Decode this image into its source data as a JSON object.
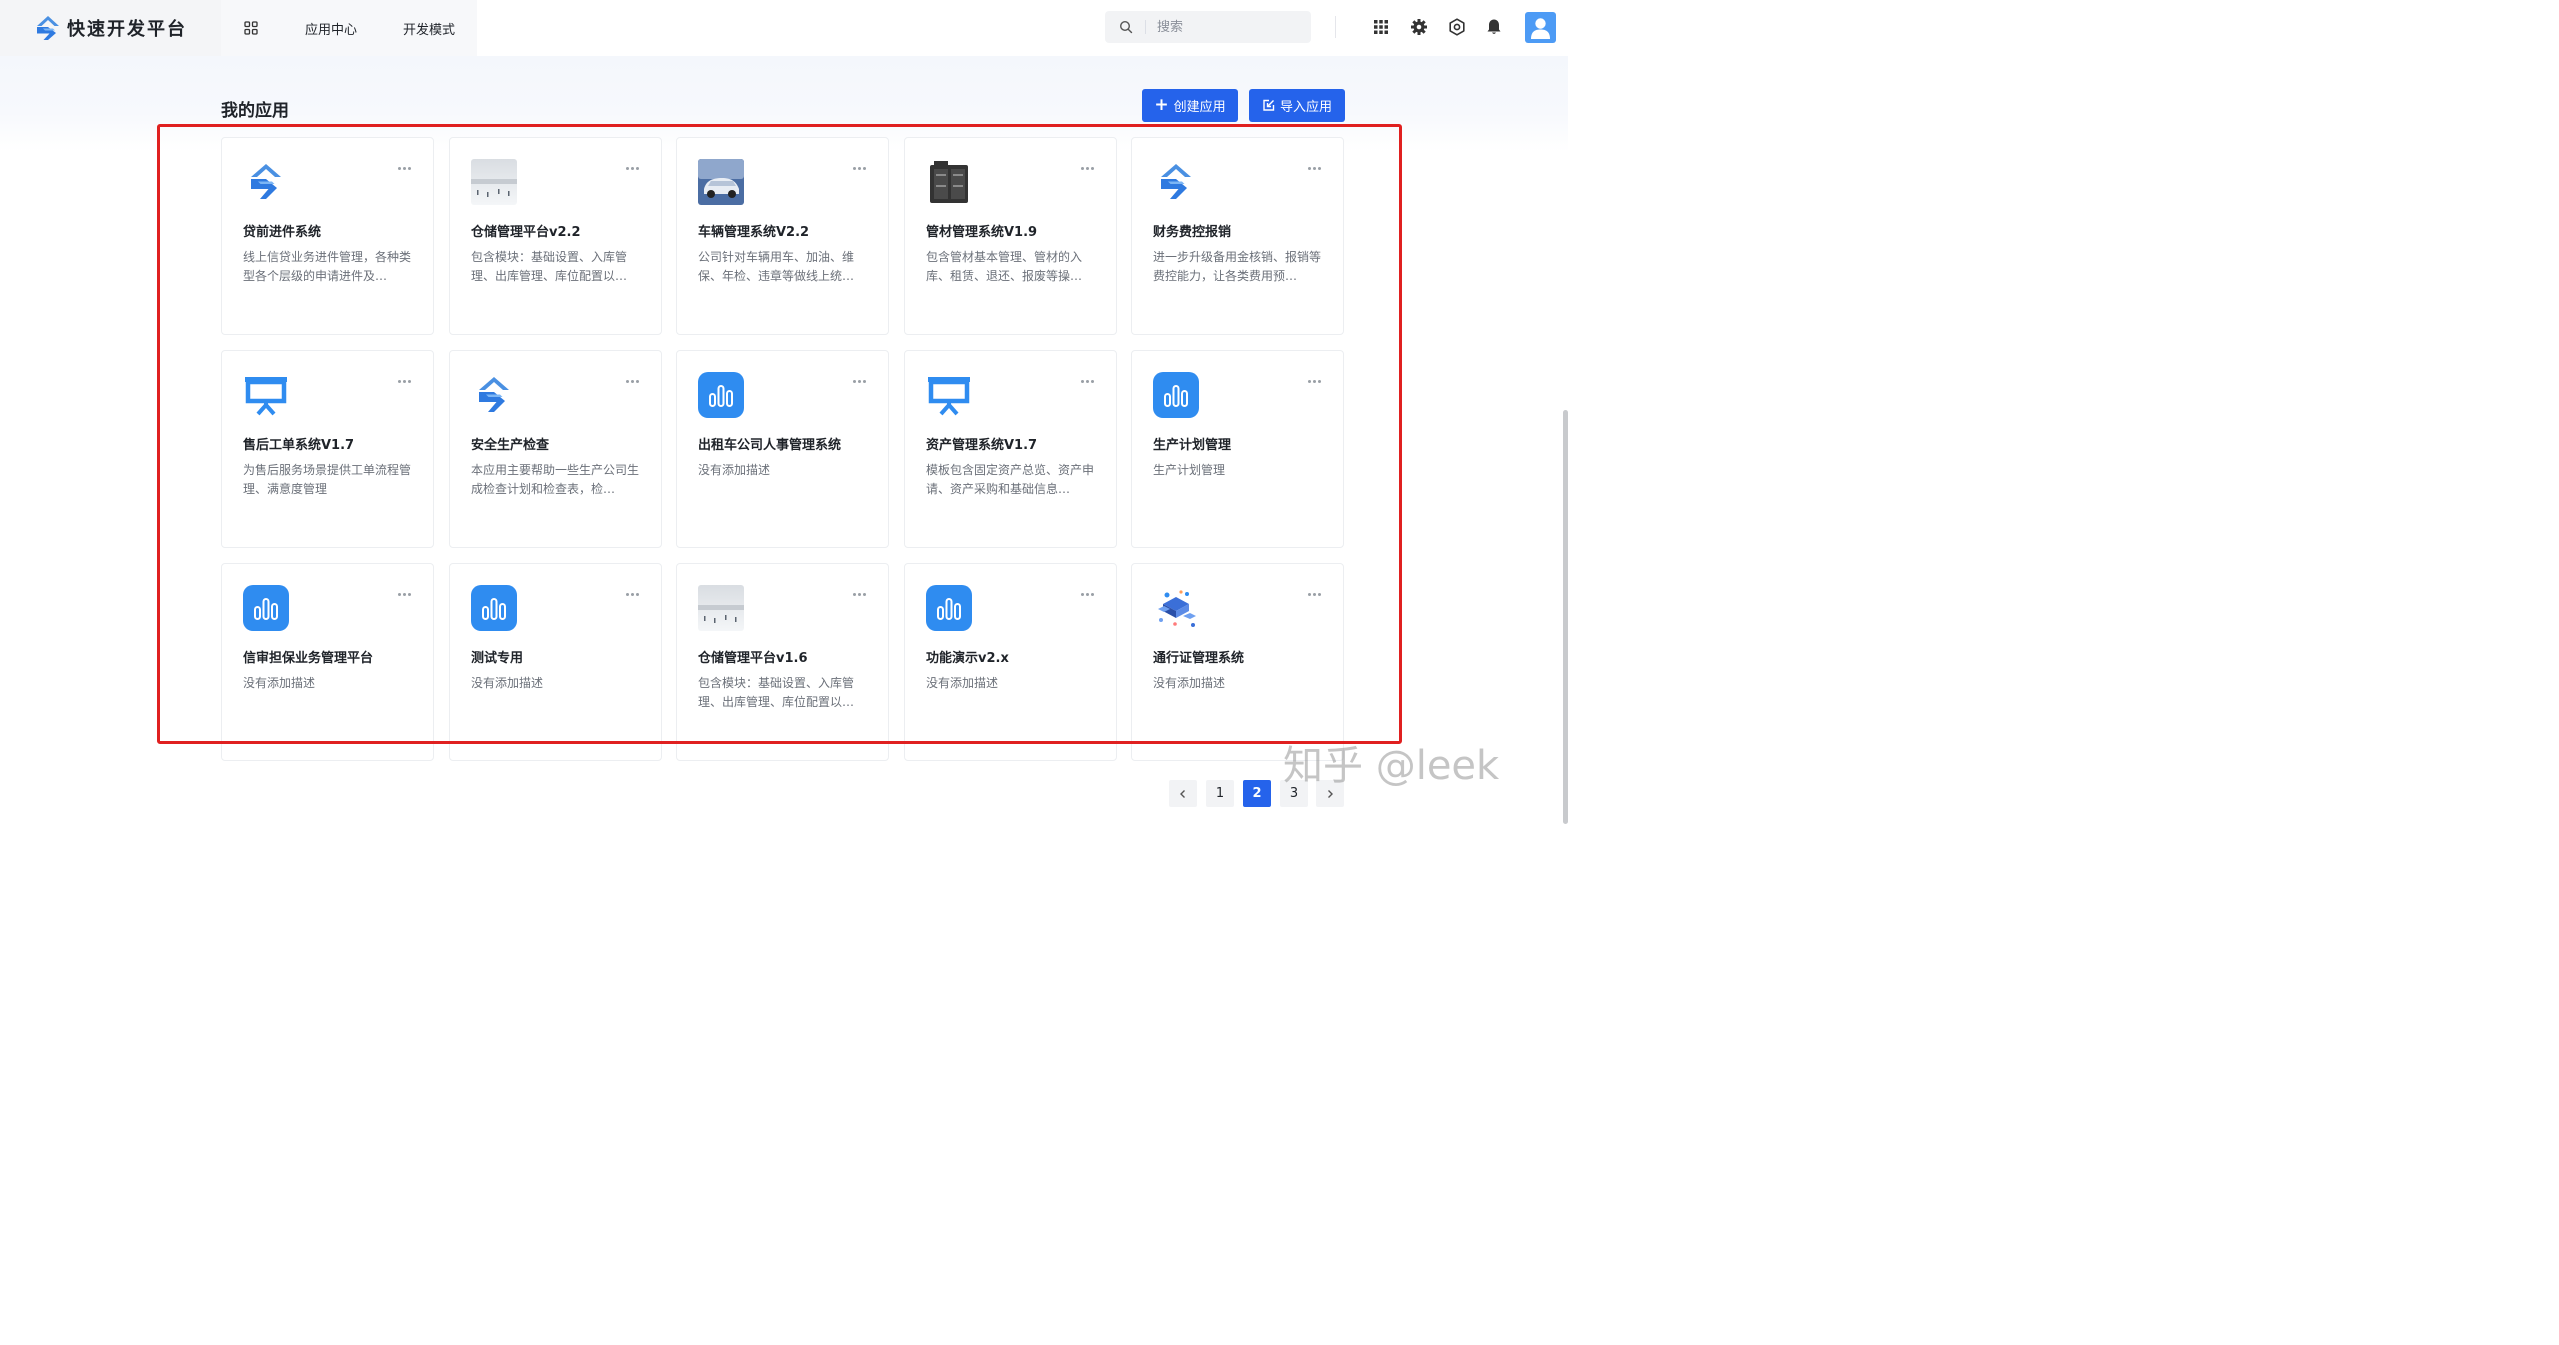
{
  "header": {
    "brand_name": "快速开发平台",
    "nav": {
      "app_center": "应用中心",
      "dev_mode": "开发模式"
    },
    "search": {
      "placeholder": "搜索"
    },
    "icons": [
      "apps-grid-icon",
      "settings-icon",
      "gear-icon",
      "bell-icon",
      "user-avatar"
    ]
  },
  "main": {
    "section_title": "我的应用",
    "create_label": "创建应用",
    "import_label": "导入应用"
  },
  "apps": [
    {
      "title": "贷前进件系统",
      "desc": "线上信贷业务进件管理，各种类型各个层级的申请进件及…",
      "icon": "brand-logo-icon"
    },
    {
      "title": "仓储管理平台v2.2",
      "desc": "包含模块：基础设置、入库管理、出库管理、库位配置以…",
      "icon": "warehouse-photo-icon"
    },
    {
      "title": "车辆管理系统V2.2",
      "desc": "公司针对车辆用车、加油、维保、年检、违章等做线上统…",
      "icon": "car-photo-icon"
    },
    {
      "title": "管材管理系统V1.9",
      "desc": "包含管材基本管理、管材的入库、租赁、退还、报废等操…",
      "icon": "cabinet-icon"
    },
    {
      "title": "财务费控报销",
      "desc": "进一步升级备用金核销、报销等费控能力，让各类费用预…",
      "icon": "brand-logo-icon"
    },
    {
      "title": "售后工单系统V1.7",
      "desc": "为售后服务场景提供工单流程管理、满意度管理",
      "icon": "presentation-board-icon"
    },
    {
      "title": "安全生产检查",
      "desc": "本应用主要帮助一些生产公司生成检查计划和检查表，检…",
      "icon": "brand-logo-icon"
    },
    {
      "title": "出租车公司人事管理系统",
      "desc": "没有添加描述",
      "icon": "bar-chart-icon"
    },
    {
      "title": "资产管理系统V1.7",
      "desc": "模板包含固定资产总览、资产申请、资产采购和基础信息…",
      "icon": "presentation-board-icon"
    },
    {
      "title": "生产计划管理",
      "desc": "生产计划管理",
      "icon": "bar-chart-icon"
    },
    {
      "title": "信审担保业务管理平台",
      "desc": "没有添加描述",
      "icon": "bar-chart-icon"
    },
    {
      "title": "测试专用",
      "desc": "没有添加描述",
      "icon": "bar-chart-icon"
    },
    {
      "title": "仓储管理平台v1.6",
      "desc": "包含模块：基础设置、入库管理、出库管理、库位配置以…",
      "icon": "warehouse-photo-icon"
    },
    {
      "title": "功能演示v2.x",
      "desc": "没有添加描述",
      "icon": "bar-chart-icon"
    },
    {
      "title": "通行证管理系统",
      "desc": "没有添加描述",
      "icon": "isometric-network-icon"
    }
  ],
  "pagination": {
    "pages": [
      "1",
      "2",
      "3"
    ],
    "current": "2"
  },
  "watermark": "知乎 @leek",
  "colors": {
    "primary": "#2563eb",
    "icon_blue": "#2f8cf0",
    "highlight_frame": "#e02020"
  }
}
